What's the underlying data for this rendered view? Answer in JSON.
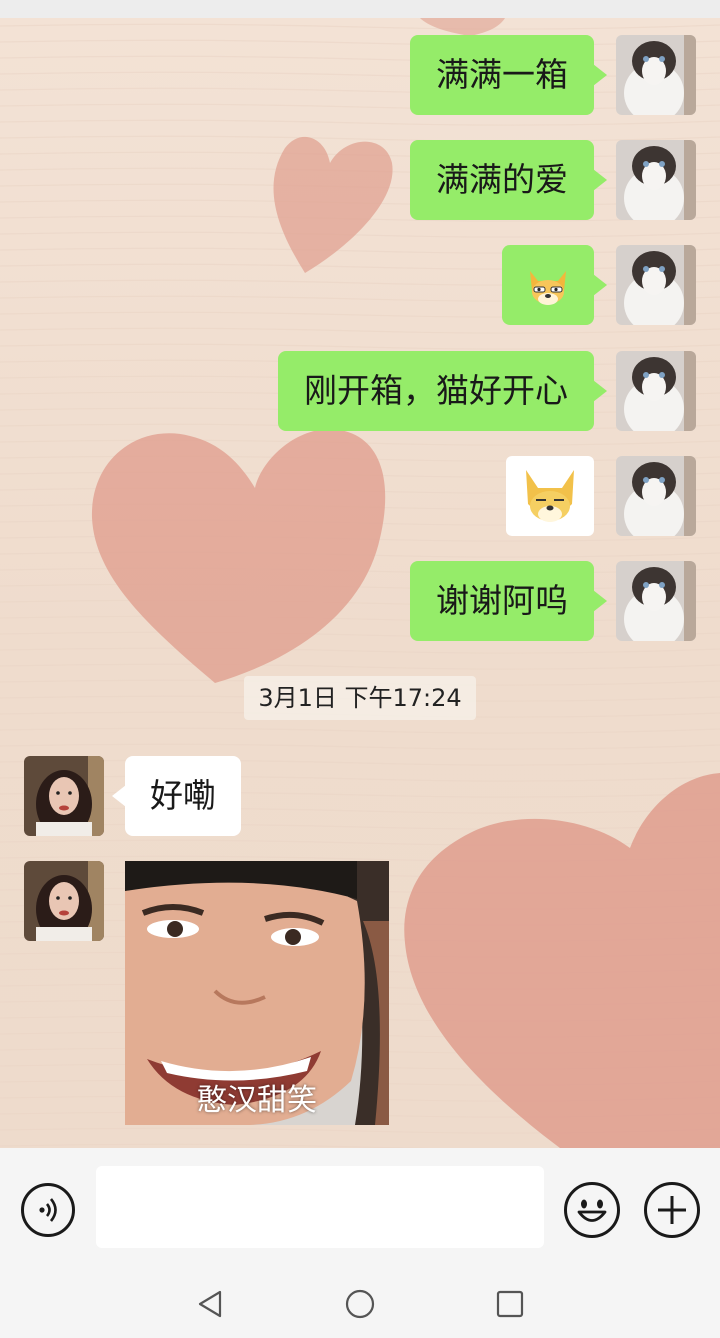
{
  "messages_out": [
    {
      "type": "text",
      "text": "满满一箱"
    },
    {
      "type": "text",
      "text": "满满的爱"
    },
    {
      "type": "sticker",
      "icon": "doge-emoji-icon"
    },
    {
      "type": "text",
      "text": "刚开箱，猫好开心"
    },
    {
      "type": "sticker",
      "icon": "cartoon-dog-icon"
    },
    {
      "type": "text",
      "text": "谢谢阿呜"
    }
  ],
  "timestamp": "3月1日 下午17:24",
  "messages_in": [
    {
      "type": "text",
      "text": "好嘞"
    },
    {
      "type": "image",
      "caption": "憨汉甜笑"
    }
  ],
  "input": {
    "value": "",
    "placeholder": ""
  },
  "colors": {
    "bubble_out": "#95ec69",
    "bubble_in": "#ffffff",
    "wallpaper": "#f3e2d5",
    "heart": "#e0a191"
  },
  "icons": {
    "voice": "voice-icon",
    "emoji": "emoji-icon",
    "plus": "plus-icon",
    "back": "back-icon",
    "home": "home-icon",
    "recent": "recent-apps-icon"
  }
}
